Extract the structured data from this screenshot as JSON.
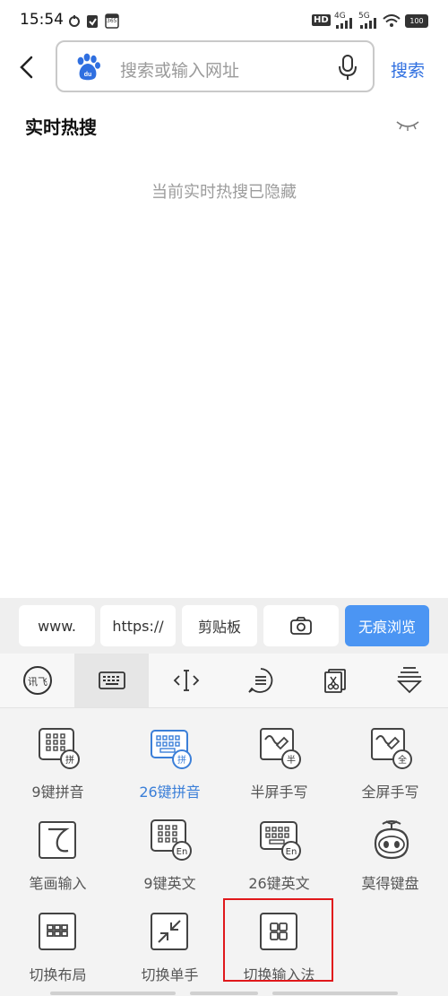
{
  "status_bar": {
    "time": "15:54",
    "hd": "HD",
    "net1": "4G",
    "net2": "5G",
    "battery": "100",
    "app_badge": "365"
  },
  "search": {
    "placeholder": "搜索或输入网址",
    "button": "搜索"
  },
  "hot": {
    "title": "实时热搜",
    "hidden_message": "当前实时热搜已隐藏"
  },
  "quick_row": [
    "www.",
    "https://",
    "剪贴板",
    "",
    "无痕浏览"
  ],
  "toolbar_icons": [
    "xunfei-logo-icon",
    "keyboard-icon",
    "cursor-icon",
    "menu-icon",
    "clipboard-scissors-icon",
    "collapse-keyboard-icon"
  ],
  "grid": [
    {
      "label": "9键拼音",
      "badge": "拼",
      "active": false
    },
    {
      "label": "26键拼音",
      "badge": "拼",
      "active": true
    },
    {
      "label": "半屏手写",
      "badge": "半",
      "active": false
    },
    {
      "label": "全屏手写",
      "badge": "全",
      "active": false
    },
    {
      "label": "笔画输入",
      "badge": "",
      "active": false
    },
    {
      "label": "9键英文",
      "badge": "En",
      "active": false
    },
    {
      "label": "26键英文",
      "badge": "En",
      "active": false
    },
    {
      "label": "莫得键盘",
      "badge": "",
      "active": false
    },
    {
      "label": "切换布局",
      "badge": "",
      "active": false
    },
    {
      "label": "切换单手",
      "badge": "",
      "active": false
    },
    {
      "label": "切换输入法",
      "badge": "",
      "active": false
    }
  ],
  "colors": {
    "accent": "#2f6fe0",
    "quick_accent": "#4b95f3",
    "highlight": "#e0181b"
  }
}
